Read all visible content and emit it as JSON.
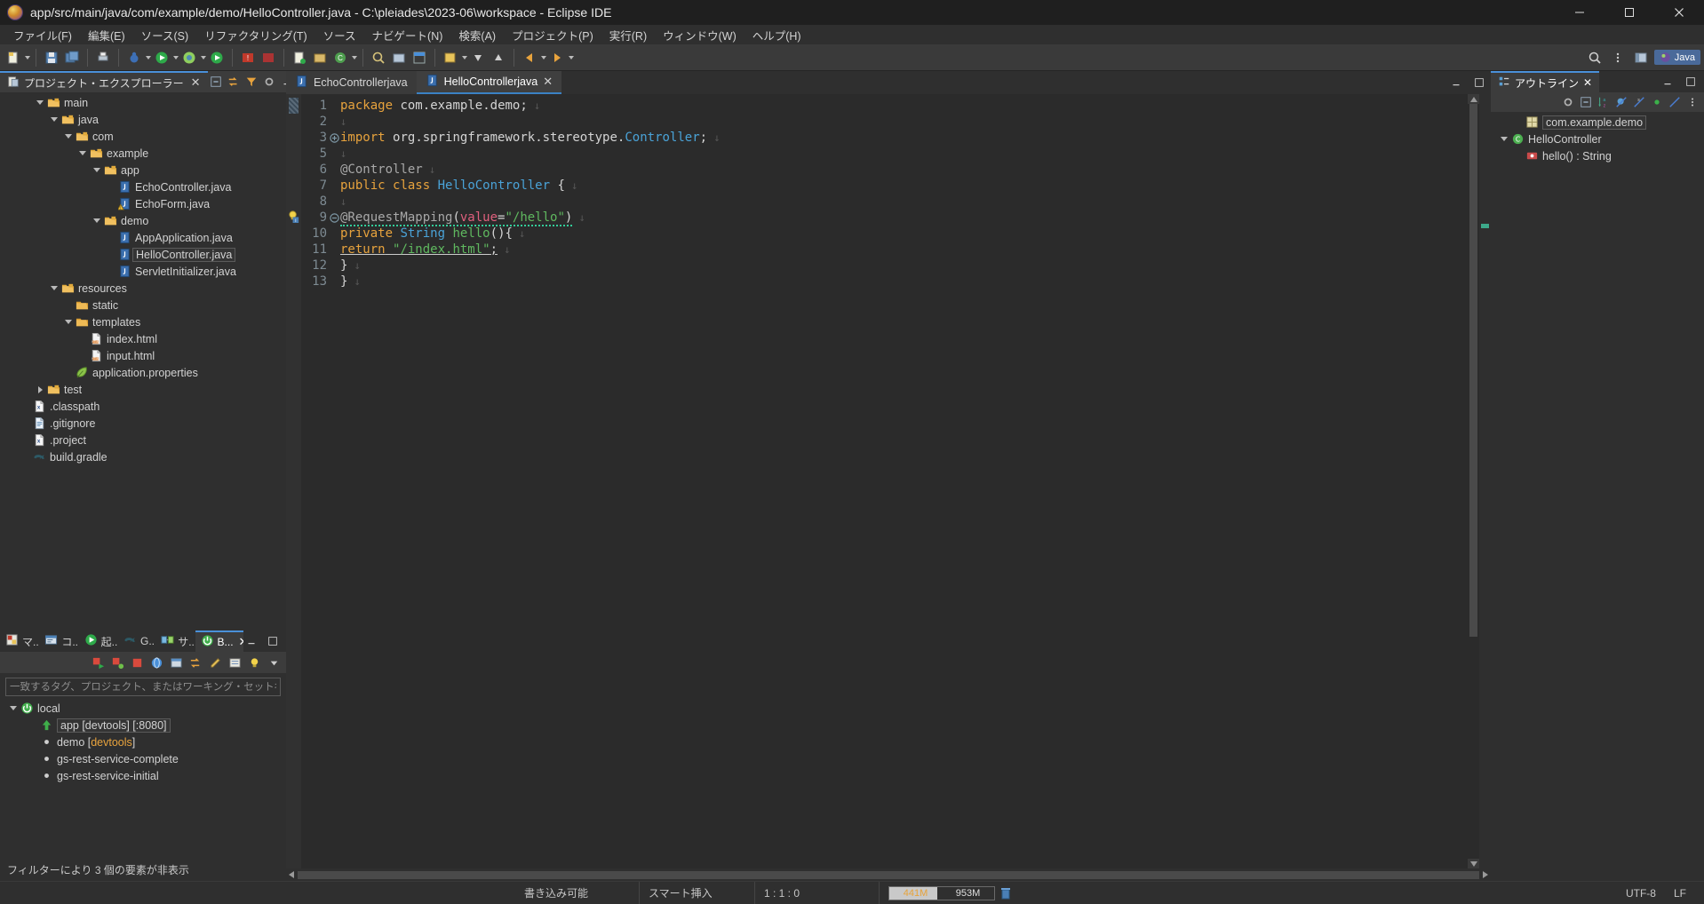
{
  "window": {
    "title": "app/src/main/java/com/example/demo/HelloController.java - C:\\pleiades\\2023-06\\workspace - Eclipse IDE",
    "minimize_label": "–",
    "maximize_label": "❐",
    "close_label": "✕"
  },
  "menubar": {
    "items": [
      {
        "label": "ファイル(F)"
      },
      {
        "label": "編集(E)"
      },
      {
        "label": "ソース(S)"
      },
      {
        "label": "リファクタリング(T)"
      },
      {
        "label": "ソース"
      },
      {
        "label": "ナビゲート(N)"
      },
      {
        "label": "検索(A)"
      },
      {
        "label": "プロジェクト(P)"
      },
      {
        "label": "実行(R)"
      },
      {
        "label": "ウィンドウ(W)"
      },
      {
        "label": "ヘルプ(H)"
      }
    ]
  },
  "toolbar": {
    "perspective_label": "Java",
    "search_icon": "search-icon"
  },
  "project_explorer": {
    "tab_label": "プロジェクト・エクスプローラー",
    "close_label": "✕",
    "tree": [
      {
        "label": "main",
        "depth": 2,
        "twisty": "down",
        "icon": "folder-src-icon"
      },
      {
        "label": "java",
        "depth": 3,
        "twisty": "down",
        "icon": "folder-src-icon"
      },
      {
        "label": "com",
        "depth": 4,
        "twisty": "down",
        "icon": "folder-src-icon"
      },
      {
        "label": "example",
        "depth": 5,
        "twisty": "down",
        "icon": "folder-src-icon"
      },
      {
        "label": "app",
        "depth": 6,
        "twisty": "down",
        "icon": "folder-src-icon"
      },
      {
        "label": "EchoController.java",
        "depth": 7,
        "twisty": "none",
        "icon": "java-file-icon"
      },
      {
        "label": "EchoForm.java",
        "depth": 7,
        "twisty": "none",
        "icon": "java-file-warning-icon"
      },
      {
        "label": "demo",
        "depth": 6,
        "twisty": "down",
        "icon": "folder-src-icon"
      },
      {
        "label": "AppApplication.java",
        "depth": 7,
        "twisty": "none",
        "icon": "java-file-icon"
      },
      {
        "label": "HelloController.java",
        "depth": 7,
        "twisty": "none",
        "icon": "java-file-icon",
        "selected": true
      },
      {
        "label": "ServletInitializer.java",
        "depth": 7,
        "twisty": "none",
        "icon": "java-file-icon"
      },
      {
        "label": "resources",
        "depth": 3,
        "twisty": "down",
        "icon": "folder-src-icon"
      },
      {
        "label": "static",
        "depth": 4,
        "twisty": "none",
        "icon": "folder-icon"
      },
      {
        "label": "templates",
        "depth": 4,
        "twisty": "down",
        "icon": "folder-icon"
      },
      {
        "label": "index.html",
        "depth": 5,
        "twisty": "none",
        "icon": "html-file-icon"
      },
      {
        "label": "input.html",
        "depth": 5,
        "twisty": "none",
        "icon": "html-file-icon"
      },
      {
        "label": "application.properties",
        "depth": 4,
        "twisty": "none",
        "icon": "leaf-icon"
      },
      {
        "label": "test",
        "depth": 2,
        "twisty": "right",
        "icon": "folder-src-icon"
      },
      {
        "label": ".classpath",
        "depth": 1,
        "twisty": "none",
        "icon": "xml-file-icon"
      },
      {
        "label": ".gitignore",
        "depth": 1,
        "twisty": "none",
        "icon": "text-file-icon"
      },
      {
        "label": ".project",
        "depth": 1,
        "twisty": "none",
        "icon": "xml-file-icon"
      },
      {
        "label": "build.gradle",
        "depth": 1,
        "twisty": "none",
        "icon": "gradle-icon"
      }
    ]
  },
  "boot_dashboard": {
    "tabs": [
      {
        "label": "マ...",
        "icon": "markers-icon",
        "active": false
      },
      {
        "label": "コ...",
        "icon": "console-icon",
        "active": false
      },
      {
        "label": "起...",
        "icon": "run-icon",
        "active": false
      },
      {
        "label": "G...",
        "icon": "gradle-icon",
        "active": false
      },
      {
        "label": "サ...",
        "icon": "servers-icon",
        "active": false
      },
      {
        "label": "B...",
        "icon": "boot-icon",
        "active": true
      }
    ],
    "close_label": "✕",
    "filter_placeholder": "一致するタグ、プロジェクト、またはワーキング・セット名を入力します",
    "filter_value": "",
    "tree": [
      {
        "label": "local",
        "depth": 0,
        "twisty": "down",
        "icon": "power-green-icon"
      },
      {
        "label": "app [devtools] [:8080]",
        "depth": 1,
        "twisty": "none",
        "icon": "up-arrow-green-icon",
        "boxed": true
      },
      {
        "label": "demo [devtools]",
        "depth": 1,
        "twisty": "none",
        "icon": "dot-icon",
        "suffix": "devtools"
      },
      {
        "label": "gs-rest-service-complete",
        "depth": 1,
        "twisty": "none",
        "icon": "dot-icon"
      },
      {
        "label": "gs-rest-service-initial",
        "depth": 1,
        "twisty": "none",
        "icon": "dot-icon"
      }
    ],
    "status_text": "フィルターにより 3 個の要素が非表示"
  },
  "editor": {
    "tabs": [
      {
        "label": "EchoControllerjava",
        "active": false,
        "icon": "java-file-icon",
        "closable": false
      },
      {
        "label": "HelloControllerjava",
        "active": true,
        "icon": "java-file-icon",
        "closable": true
      }
    ],
    "close_label": "✕",
    "lines": [
      {
        "num": "1",
        "marker": "",
        "fold": "",
        "text": "package com.example.demo;"
      },
      {
        "num": "2",
        "marker": "",
        "fold": "",
        "text": ""
      },
      {
        "num": "3",
        "marker": "",
        "fold": "+",
        "text": "import org.springframework.stereotype.Controller;"
      },
      {
        "num": "5",
        "marker": "",
        "fold": "",
        "text": ""
      },
      {
        "num": "6",
        "marker": "",
        "fold": "",
        "text": "@Controller"
      },
      {
        "num": "7",
        "marker": "",
        "fold": "",
        "text": "public class HelloController {"
      },
      {
        "num": "8",
        "marker": "",
        "fold": "",
        "text": ""
      },
      {
        "num": "9",
        "marker": "bulb",
        "fold": "-",
        "text": "@RequestMapping(value=\"/hello\")"
      },
      {
        "num": "10",
        "marker": "",
        "fold": "",
        "text": "private String hello(){"
      },
      {
        "num": "11",
        "marker": "",
        "fold": "",
        "text": "return \"/index.html\";"
      },
      {
        "num": "12",
        "marker": "",
        "fold": "",
        "text": "}"
      },
      {
        "num": "13",
        "marker": "",
        "fold": "",
        "text": "}"
      }
    ]
  },
  "outline": {
    "tab_label": "アウトライン",
    "close_label": "✕",
    "tree": [
      {
        "label": "com.example.demo",
        "depth": 1,
        "twisty": "none",
        "icon": "package-icon",
        "boxed": true
      },
      {
        "label": "HelloController",
        "depth": 0,
        "twisty": "down",
        "icon": "class-icon"
      },
      {
        "label": "hello() : String",
        "depth": 1,
        "twisty": "none",
        "icon": "method-private-icon"
      }
    ]
  },
  "statusbar": {
    "writable": "書き込み可能",
    "insert_mode": "スマート挿入",
    "position": "1 : 1 : 0",
    "mem_used": "441M",
    "mem_total": "953M",
    "encoding": "UTF-8",
    "line_ending": "LF"
  },
  "colors": {
    "accent": "#4a90d9",
    "tab_underline": "#3b82c4",
    "keyword": "#e8a33d",
    "class": "#4aa3d8",
    "string": "#5fb85f",
    "annotation": "#a8a8a8",
    "attr_value": "#e0607e",
    "bg": "#2f2f2f",
    "editor_bg": "#2b2b2b"
  }
}
